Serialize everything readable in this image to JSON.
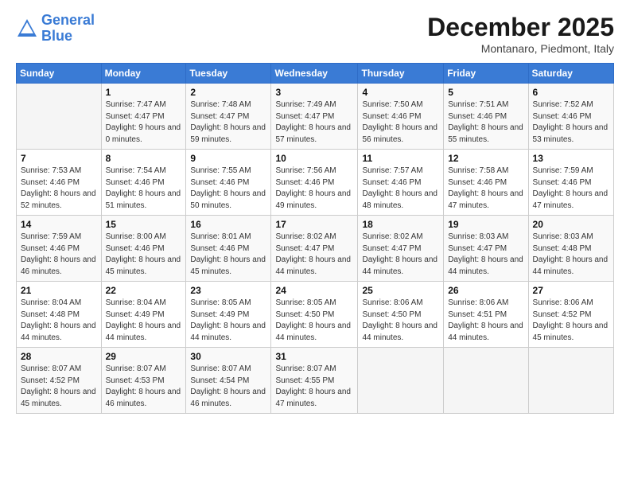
{
  "logo": {
    "line1": "General",
    "line2": "Blue"
  },
  "header": {
    "title": "December 2025",
    "subtitle": "Montanaro, Piedmont, Italy"
  },
  "weekdays": [
    "Sunday",
    "Monday",
    "Tuesday",
    "Wednesday",
    "Thursday",
    "Friday",
    "Saturday"
  ],
  "weeks": [
    [
      {
        "day": "",
        "info": ""
      },
      {
        "day": "1",
        "info": "Sunrise: 7:47 AM\nSunset: 4:47 PM\nDaylight: 9 hours\nand 0 minutes."
      },
      {
        "day": "2",
        "info": "Sunrise: 7:48 AM\nSunset: 4:47 PM\nDaylight: 8 hours\nand 59 minutes."
      },
      {
        "day": "3",
        "info": "Sunrise: 7:49 AM\nSunset: 4:47 PM\nDaylight: 8 hours\nand 57 minutes."
      },
      {
        "day": "4",
        "info": "Sunrise: 7:50 AM\nSunset: 4:46 PM\nDaylight: 8 hours\nand 56 minutes."
      },
      {
        "day": "5",
        "info": "Sunrise: 7:51 AM\nSunset: 4:46 PM\nDaylight: 8 hours\nand 55 minutes."
      },
      {
        "day": "6",
        "info": "Sunrise: 7:52 AM\nSunset: 4:46 PM\nDaylight: 8 hours\nand 53 minutes."
      }
    ],
    [
      {
        "day": "7",
        "info": "Sunrise: 7:53 AM\nSunset: 4:46 PM\nDaylight: 8 hours\nand 52 minutes."
      },
      {
        "day": "8",
        "info": "Sunrise: 7:54 AM\nSunset: 4:46 PM\nDaylight: 8 hours\nand 51 minutes."
      },
      {
        "day": "9",
        "info": "Sunrise: 7:55 AM\nSunset: 4:46 PM\nDaylight: 8 hours\nand 50 minutes."
      },
      {
        "day": "10",
        "info": "Sunrise: 7:56 AM\nSunset: 4:46 PM\nDaylight: 8 hours\nand 49 minutes."
      },
      {
        "day": "11",
        "info": "Sunrise: 7:57 AM\nSunset: 4:46 PM\nDaylight: 8 hours\nand 48 minutes."
      },
      {
        "day": "12",
        "info": "Sunrise: 7:58 AM\nSunset: 4:46 PM\nDaylight: 8 hours\nand 47 minutes."
      },
      {
        "day": "13",
        "info": "Sunrise: 7:59 AM\nSunset: 4:46 PM\nDaylight: 8 hours\nand 47 minutes."
      }
    ],
    [
      {
        "day": "14",
        "info": "Sunrise: 7:59 AM\nSunset: 4:46 PM\nDaylight: 8 hours\nand 46 minutes."
      },
      {
        "day": "15",
        "info": "Sunrise: 8:00 AM\nSunset: 4:46 PM\nDaylight: 8 hours\nand 45 minutes."
      },
      {
        "day": "16",
        "info": "Sunrise: 8:01 AM\nSunset: 4:46 PM\nDaylight: 8 hours\nand 45 minutes."
      },
      {
        "day": "17",
        "info": "Sunrise: 8:02 AM\nSunset: 4:47 PM\nDaylight: 8 hours\nand 44 minutes."
      },
      {
        "day": "18",
        "info": "Sunrise: 8:02 AM\nSunset: 4:47 PM\nDaylight: 8 hours\nand 44 minutes."
      },
      {
        "day": "19",
        "info": "Sunrise: 8:03 AM\nSunset: 4:47 PM\nDaylight: 8 hours\nand 44 minutes."
      },
      {
        "day": "20",
        "info": "Sunrise: 8:03 AM\nSunset: 4:48 PM\nDaylight: 8 hours\nand 44 minutes."
      }
    ],
    [
      {
        "day": "21",
        "info": "Sunrise: 8:04 AM\nSunset: 4:48 PM\nDaylight: 8 hours\nand 44 minutes."
      },
      {
        "day": "22",
        "info": "Sunrise: 8:04 AM\nSunset: 4:49 PM\nDaylight: 8 hours\nand 44 minutes."
      },
      {
        "day": "23",
        "info": "Sunrise: 8:05 AM\nSunset: 4:49 PM\nDaylight: 8 hours\nand 44 minutes."
      },
      {
        "day": "24",
        "info": "Sunrise: 8:05 AM\nSunset: 4:50 PM\nDaylight: 8 hours\nand 44 minutes."
      },
      {
        "day": "25",
        "info": "Sunrise: 8:06 AM\nSunset: 4:50 PM\nDaylight: 8 hours\nand 44 minutes."
      },
      {
        "day": "26",
        "info": "Sunrise: 8:06 AM\nSunset: 4:51 PM\nDaylight: 8 hours\nand 44 minutes."
      },
      {
        "day": "27",
        "info": "Sunrise: 8:06 AM\nSunset: 4:52 PM\nDaylight: 8 hours\nand 45 minutes."
      }
    ],
    [
      {
        "day": "28",
        "info": "Sunrise: 8:07 AM\nSunset: 4:52 PM\nDaylight: 8 hours\nand 45 minutes."
      },
      {
        "day": "29",
        "info": "Sunrise: 8:07 AM\nSunset: 4:53 PM\nDaylight: 8 hours\nand 46 minutes."
      },
      {
        "day": "30",
        "info": "Sunrise: 8:07 AM\nSunset: 4:54 PM\nDaylight: 8 hours\nand 46 minutes."
      },
      {
        "day": "31",
        "info": "Sunrise: 8:07 AM\nSunset: 4:55 PM\nDaylight: 8 hours\nand 47 minutes."
      },
      {
        "day": "",
        "info": ""
      },
      {
        "day": "",
        "info": ""
      },
      {
        "day": "",
        "info": ""
      }
    ]
  ]
}
